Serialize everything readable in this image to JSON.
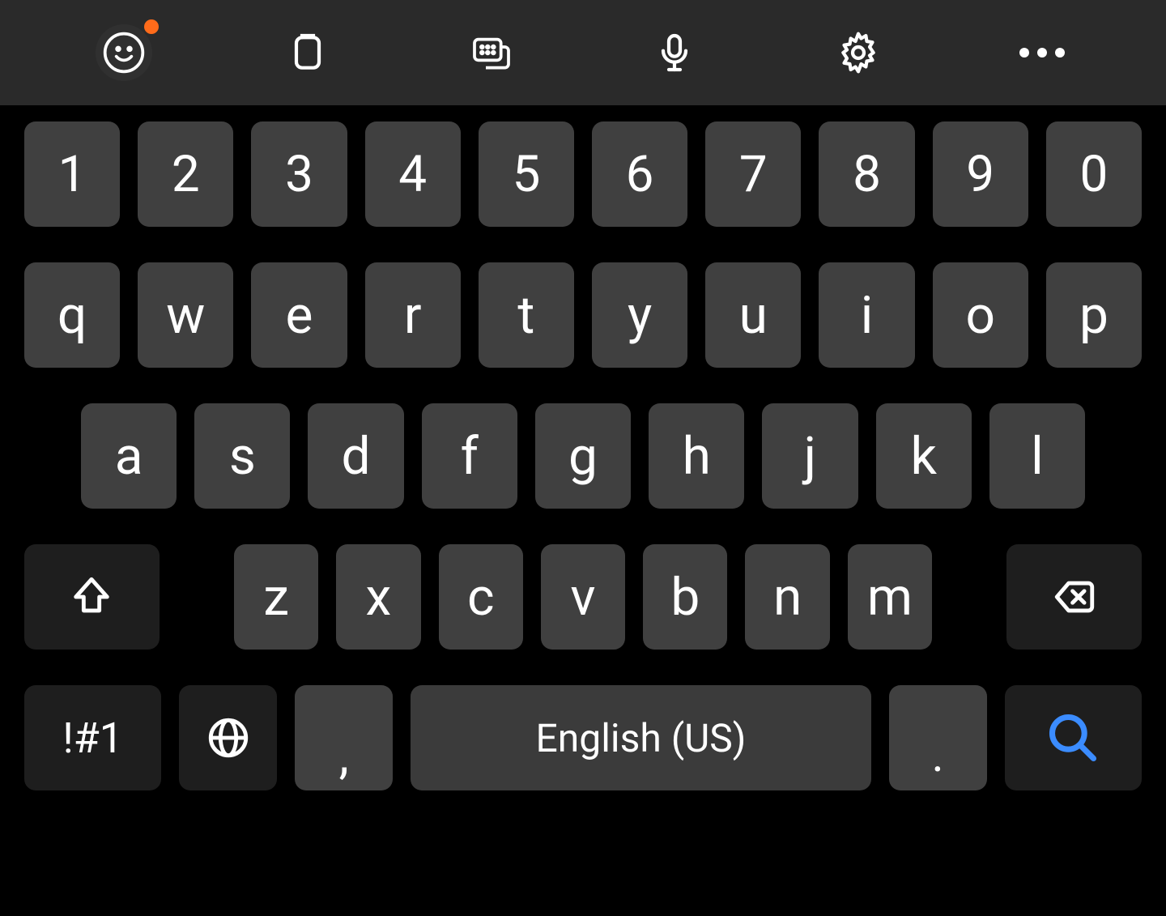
{
  "toolbar": {
    "emoji_notification": true
  },
  "rows": {
    "numbers": [
      "1",
      "2",
      "3",
      "4",
      "5",
      "6",
      "7",
      "8",
      "9",
      "0"
    ],
    "r2": [
      "q",
      "w",
      "e",
      "r",
      "t",
      "y",
      "u",
      "i",
      "o",
      "p"
    ],
    "r3": [
      "a",
      "s",
      "d",
      "f",
      "g",
      "h",
      "j",
      "k",
      "l"
    ],
    "r4": [
      "z",
      "x",
      "c",
      "v",
      "b",
      "n",
      "m"
    ]
  },
  "bottom": {
    "symbols_label": "!#1",
    "comma": ",",
    "space_label": "English (US)",
    "period": "."
  },
  "colors": {
    "search_icon": "#3b8cff"
  }
}
